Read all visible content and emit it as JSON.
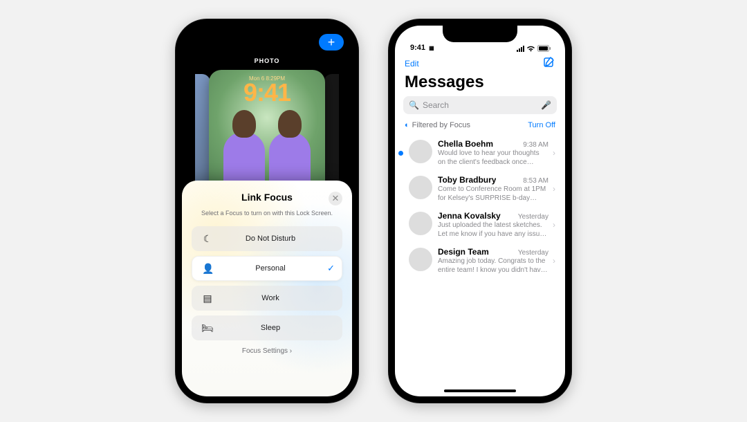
{
  "left": {
    "add_button_glyph": "+",
    "header_label": "PHOTO",
    "wallpaper": {
      "date": "Mon 6  8:29PM",
      "time": "9:41"
    },
    "sheet": {
      "title": "Link Focus",
      "subtitle": "Select a Focus to turn on with this Lock Screen.",
      "close_glyph": "✕",
      "items": [
        {
          "icon": "☾",
          "label": "Do Not Disturb",
          "selected": false
        },
        {
          "icon": "👤",
          "label": "Personal",
          "selected": true
        },
        {
          "icon": "▤",
          "label": "Work",
          "selected": false
        },
        {
          "icon": "🛏",
          "label": "Sleep",
          "selected": false
        }
      ],
      "settings_label": "Focus Settings",
      "check_glyph": "✓",
      "chevron_glyph": "›"
    }
  },
  "right": {
    "status": {
      "time": "9:41",
      "carrier_icon": "▦"
    },
    "nav": {
      "edit": "Edit",
      "compose_glyph": "✎"
    },
    "title": "Messages",
    "search": {
      "placeholder": "Search",
      "mag_glyph": "🔍",
      "mic_glyph": "🎤"
    },
    "filter": {
      "icon": "◐",
      "label": "Filtered by Focus",
      "action": "Turn Off"
    },
    "messages": [
      {
        "name": "Chella Boehm",
        "time": "9:38 AM",
        "preview": "Would love to hear your thoughts on the client's feedback once you've finished th…",
        "unread": true,
        "avatar_class": "av-1"
      },
      {
        "name": "Toby Bradbury",
        "time": "8:53 AM",
        "preview": "Come to Conference Room at 1PM for Kelsey's SURPRISE b-day celebration.",
        "unread": false,
        "avatar_class": "av-2"
      },
      {
        "name": "Jenna Kovalsky",
        "time": "Yesterday",
        "preview": "Just uploaded the latest sketches. Let me know if you have any issues accessing.",
        "unread": false,
        "avatar_class": "av-3"
      },
      {
        "name": "Design Team",
        "time": "Yesterday",
        "preview": "Amazing job today. Congrats to the entire team! I know you didn't have a lot of tim…",
        "unread": false,
        "avatar_class": "av-4"
      }
    ]
  }
}
